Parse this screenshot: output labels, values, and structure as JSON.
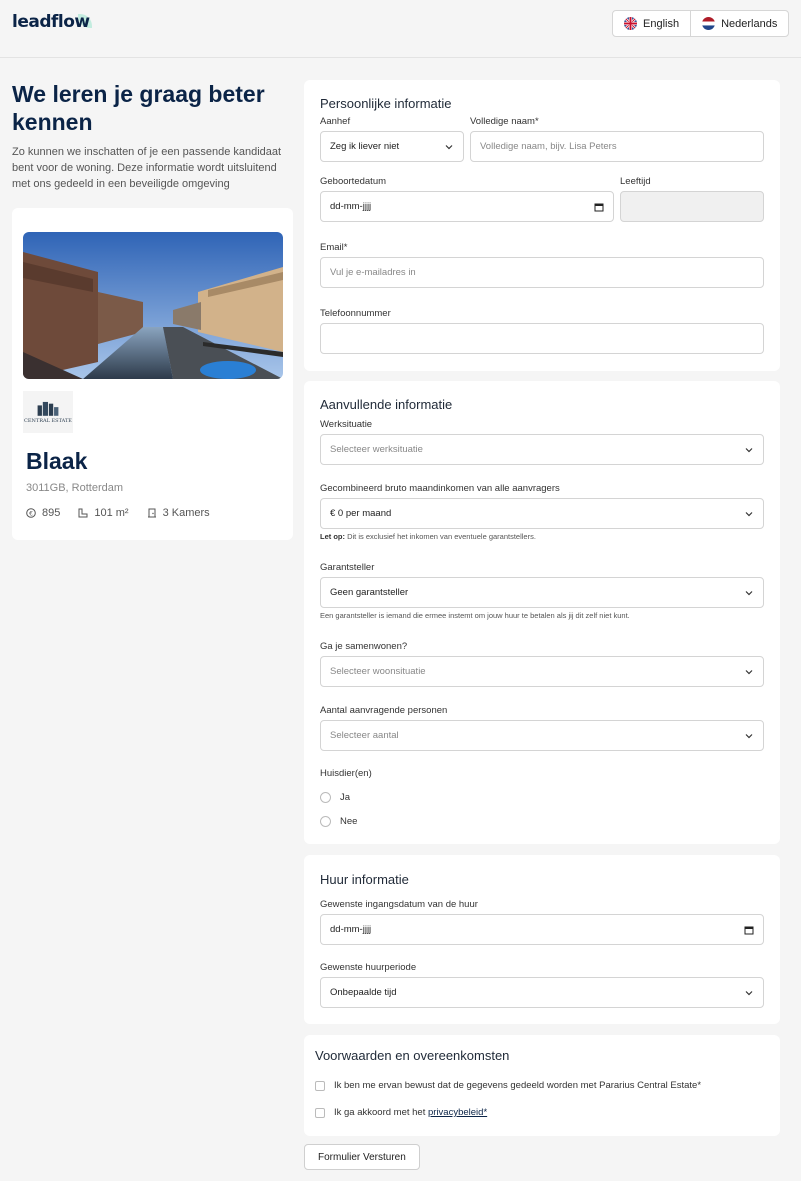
{
  "header": {
    "logo": "leadflow",
    "languages": [
      {
        "label": "English",
        "icon": "uk-flag-icon"
      },
      {
        "label": "Nederlands",
        "icon": "nl-flag-icon"
      }
    ]
  },
  "intro": {
    "title": "We leren je graag beter kennen",
    "text": "Zo kunnen we inschatten of je een passende kandidaat bent voor de woning. Deze informatie wordt uitsluitend met ons gedeeld in een beveiligde omgeving"
  },
  "property": {
    "logo_text": "CENTRAL ESTATE",
    "name": "Blaak",
    "address": "3011GB, Rotterdam",
    "price": "895",
    "area": "101 m²",
    "rooms": "3 Kamers"
  },
  "personal": {
    "title": "Persoonlijke informatie",
    "salutation_label": "Aanhef",
    "salutation_value": "Zeg ik liever niet",
    "fullname_label": "Volledige naam*",
    "fullname_placeholder": "Volledige naam, bijv. Lisa Peters",
    "birthdate_label": "Geboortedatum",
    "birthdate_placeholder": "dd-mm-jjjj",
    "age_label": "Leeftijd",
    "email_label": "Email*",
    "email_placeholder": "Vul je e-mailadres in",
    "phone_label": "Telefoonnummer"
  },
  "additional": {
    "title": "Aanvullende informatie",
    "work_label": "Werksituatie",
    "work_placeholder": "Selecteer werksituatie",
    "income_label": "Gecombineerd bruto maandinkomen van alle aanvragers",
    "income_value": "€ 0 per maand",
    "income_hint_bold": "Let op:",
    "income_hint": " Dit is exclusief het inkomen van eventuele garantstellers.",
    "guarantor_label": "Garantsteller",
    "guarantor_value": "Geen garantsteller",
    "guarantor_hint": "Een garantsteller is iemand die ermee instemt om jouw huur te betalen als jij dit zelf niet kunt.",
    "cohabit_label": "Ga je samenwonen?",
    "cohabit_placeholder": "Selecteer woonsituatie",
    "persons_label": "Aantal aanvragende personen",
    "persons_placeholder": "Selecteer aantal",
    "pets_label": "Huisdier(en)",
    "pets_yes": "Ja",
    "pets_no": "Nee"
  },
  "rental": {
    "title": "Huur informatie",
    "start_label": "Gewenste ingangsdatum van de huur",
    "start_placeholder": "dd-mm-jjjj",
    "period_label": "Gewenste huurperiode",
    "period_value": "Onbepaalde tijd"
  },
  "terms": {
    "title": "Voorwaarden en overeenkomsten",
    "consent": "Ik ben me ervan bewust dat de gegevens gedeeld worden met Pararius Central Estate*",
    "privacy_prefix": "Ik ga akkoord met het ",
    "privacy_link": "privacybeleid*"
  },
  "submit_label": "Formulier Versturen"
}
